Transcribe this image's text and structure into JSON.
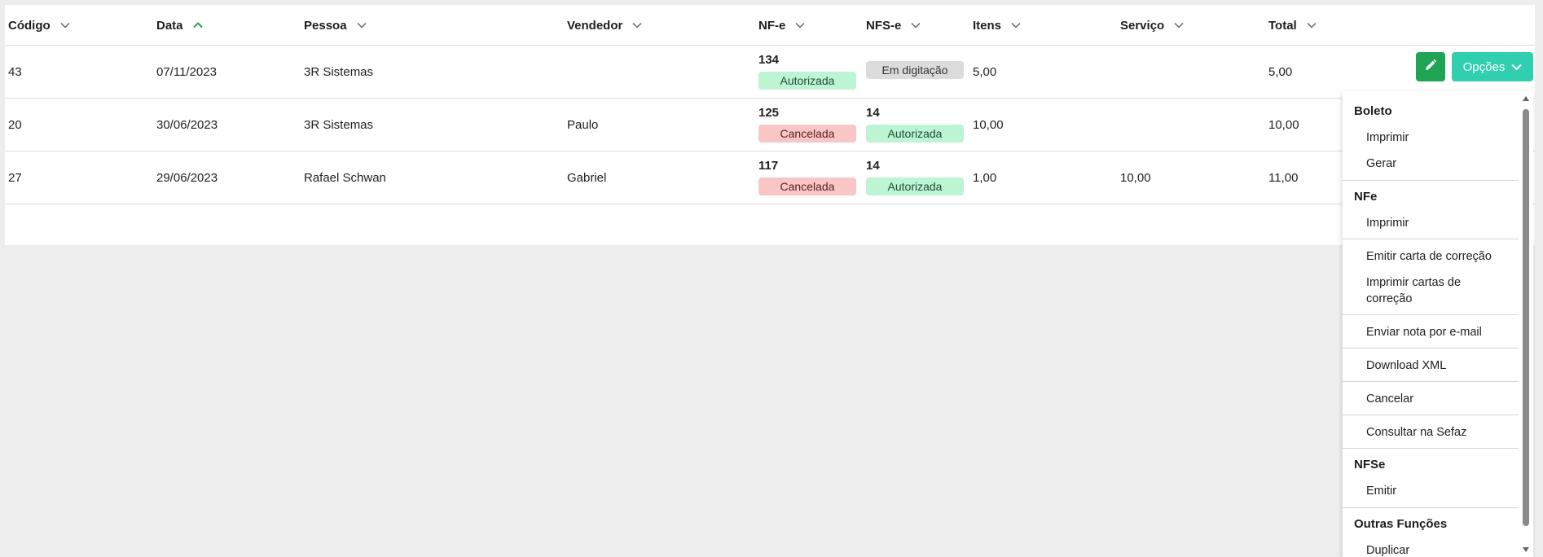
{
  "table": {
    "columns": [
      {
        "label": "Código",
        "sort": "none"
      },
      {
        "label": "Data",
        "sort": "asc"
      },
      {
        "label": "Pessoa",
        "sort": "none"
      },
      {
        "label": "Vendedor",
        "sort": "none"
      },
      {
        "label": "NF-e",
        "sort": "none"
      },
      {
        "label": "NFS-e",
        "sort": "none"
      },
      {
        "label": "Itens",
        "sort": "none"
      },
      {
        "label": "Serviço",
        "sort": "none"
      },
      {
        "label": "Total",
        "sort": "none"
      }
    ],
    "rows": [
      {
        "codigo": "43",
        "data": "07/11/2023",
        "pessoa": "3R Sistemas",
        "vendedor": "",
        "nfe_num": "134",
        "nfe_status": "Autorizada",
        "nfse_num": "",
        "nfse_status": "Em digitação",
        "itens": "5,00",
        "servico": "",
        "total": "5,00"
      },
      {
        "codigo": "20",
        "data": "30/06/2023",
        "pessoa": "3R Sistemas",
        "vendedor": "Paulo",
        "nfe_num": "125",
        "nfe_status": "Cancelada",
        "nfse_num": "14",
        "nfse_status": "Autorizada",
        "itens": "10,00",
        "servico": "",
        "total": "10,00"
      },
      {
        "codigo": "27",
        "data": "29/06/2023",
        "pessoa": "Rafael Schwan",
        "vendedor": "Gabriel",
        "nfe_num": "117",
        "nfe_status": "Cancelada",
        "nfse_num": "14",
        "nfse_status": "Autorizada",
        "itens": "1,00",
        "servico": "10,00",
        "total": "11,00"
      }
    ]
  },
  "actions": {
    "edit_icon": "pencil-icon",
    "options_label": "Opções",
    "options_icon": "chevron-down-icon"
  },
  "menu": {
    "boleto_title": "Boleto",
    "boleto_imprimir": "Imprimir",
    "boleto_gerar": "Gerar",
    "nfe_title": "NFe",
    "nfe_imprimir": "Imprimir",
    "nfe_emitir_carta": "Emitir carta de correção",
    "nfe_imprimir_cartas": "Imprimir cartas de correção",
    "nfe_enviar_email": "Enviar nota por e-mail",
    "nfe_download_xml": "Download XML",
    "nfe_cancelar": "Cancelar",
    "nfe_consultar": "Consultar na Sefaz",
    "nfse_title": "NFSe",
    "nfse_emitir": "Emitir",
    "outras_title": "Outras Funções",
    "outras_duplicar": "Duplicar"
  },
  "colors": {
    "edit_button": "#1fa354",
    "options_button": "#30cfb0",
    "badge_autorizada": "#bdf4d3",
    "badge_cancelada": "#f8c6c6",
    "badge_digitacao": "#dcdcdc",
    "sort_active": "#1fa354"
  }
}
